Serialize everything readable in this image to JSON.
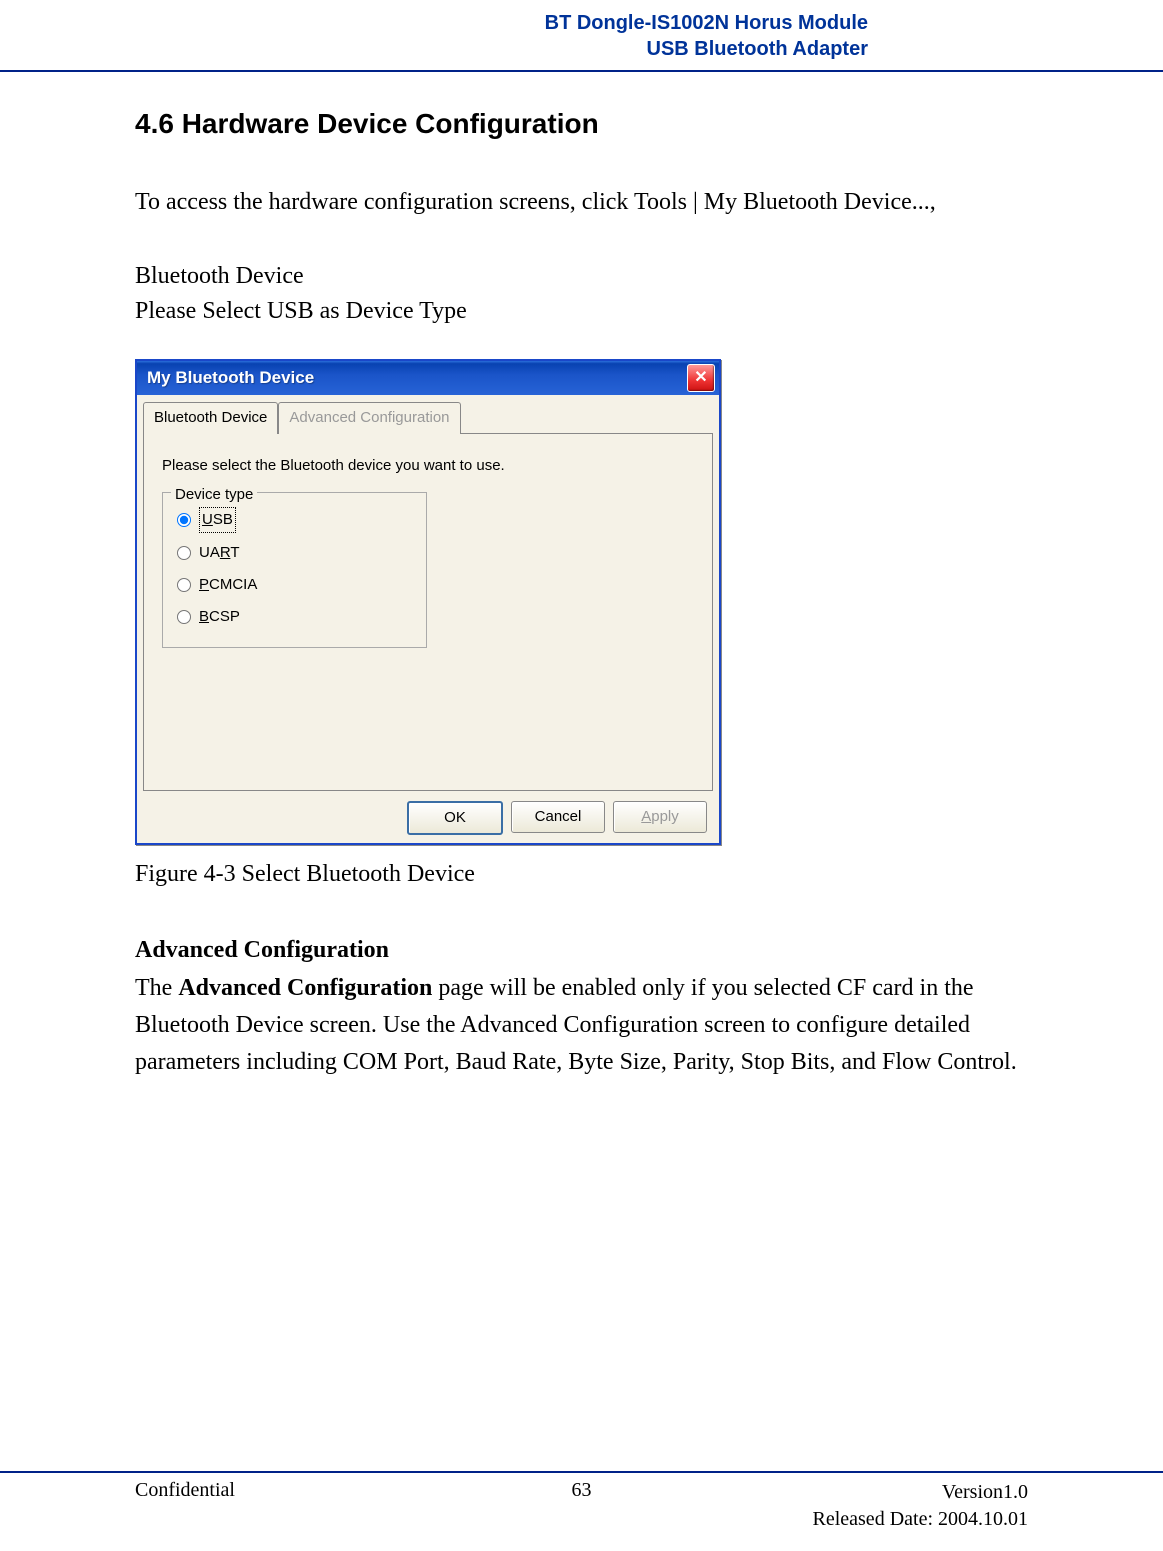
{
  "header": {
    "line1": "BT Dongle-IS1002N Horus Module",
    "line2": "USB Bluetooth Adapter"
  },
  "section": {
    "title": "4.6 Hardware Device Configuration",
    "intro": "To access the hardware configuration screens, click Tools | My Bluetooth Device...,",
    "sub1": "Bluetooth Device",
    "sub2": "Please Select USB as Device Type",
    "figure_caption": "Figure 4-3 Select Bluetooth Device",
    "adv_title": "Advanced Configuration",
    "adv_body_prefix": "The ",
    "adv_body_bold": "Advanced Configuration",
    "adv_body_rest": " page will be enabled only if you selected CF card in the Bluetooth Device screen. Use the Advanced Configuration screen to configure detailed parameters including COM Port, Baud Rate, Byte Size, Parity, Stop Bits, and Flow Control."
  },
  "dialog": {
    "title": "My Bluetooth Device",
    "tabs": {
      "active": "Bluetooth Device",
      "disabled": "Advanced Configuration"
    },
    "instructions": "Please select the Bluetooth device you want to use.",
    "group_legend": "Device type",
    "options": {
      "usb_pre": "",
      "usb_accel": "U",
      "usb_post": "SB",
      "uart_pre": "UA",
      "uart_accel": "R",
      "uart_post": "T",
      "pcmcia_pre": "",
      "pcmcia_accel": "P",
      "pcmcia_post": "CMCIA",
      "bcsp_pre": "",
      "bcsp_accel": "B",
      "bcsp_post": "CSP"
    },
    "buttons": {
      "ok": "OK",
      "cancel": "Cancel",
      "apply_pre": "",
      "apply_accel": "A",
      "apply_post": "pply"
    }
  },
  "footer": {
    "left": "Confidential",
    "center": "63",
    "right1": "Version1.0",
    "right2": "Released Date: 2004.10.01"
  }
}
